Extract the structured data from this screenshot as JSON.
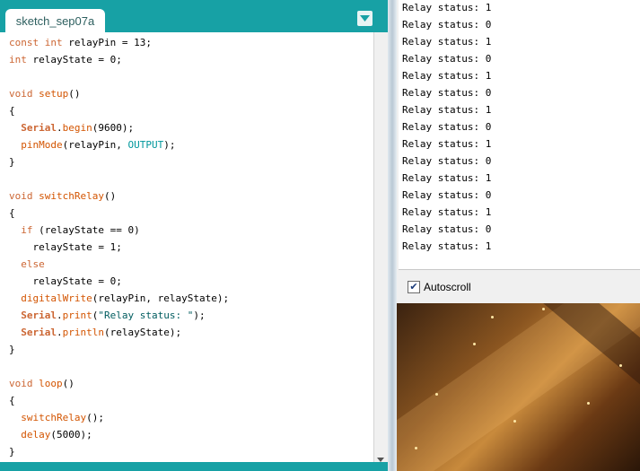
{
  "editor": {
    "tab_label": "sketch_sep07a",
    "code_lines": [
      "const int relayPin = 13;",
      "int relayState = 0;",
      "",
      "void setup()",
      "{",
      "  Serial.begin(9600);",
      "  pinMode(relayPin, OUTPUT);",
      "}",
      "",
      "void switchRelay()",
      "{",
      "  if (relayState == 0)",
      "    relayState = 1;",
      "  else",
      "    relayState = 0;",
      "  digitalWrite(relayPin, relayState);",
      "  Serial.print(\"Relay status: \");",
      "  Serial.println(relayState);",
      "}",
      "",
      "void loop()",
      "{",
      "  switchRelay();",
      "  delay(5000);",
      "}"
    ]
  },
  "serial_monitor": {
    "output_lines": [
      "Relay status: 1",
      "Relay status: 0",
      "Relay status: 1",
      "Relay status: 0",
      "Relay status: 1",
      "Relay status: 0",
      "Relay status: 1",
      "Relay status: 0",
      "Relay status: 1",
      "Relay status: 0",
      "Relay status: 1",
      "Relay status: 0",
      "Relay status: 1",
      "Relay status: 0",
      "Relay status: 1"
    ],
    "autoscroll_label": "Autoscroll",
    "autoscroll_checked": true
  },
  "colors": {
    "ide_teal": "#17a1a5",
    "keyword": "#cc6633",
    "constant": "#00979c"
  }
}
